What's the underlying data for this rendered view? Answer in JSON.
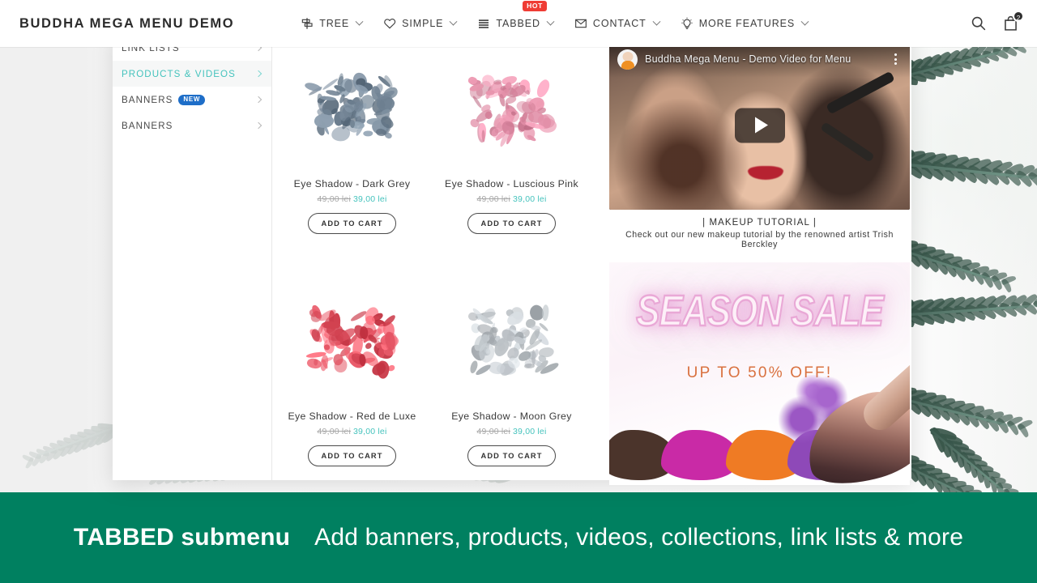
{
  "header": {
    "logo": "BUDDHA MEGA MENU DEMO",
    "nav": [
      {
        "label": "TREE",
        "icon": "signpost-icon",
        "badge": null
      },
      {
        "label": "SIMPLE",
        "icon": "heart-icon",
        "badge": null
      },
      {
        "label": "TABBED",
        "icon": "bars-icon",
        "badge": "HOT"
      },
      {
        "label": "CONTACT",
        "icon": "envelope-icon",
        "badge": null
      },
      {
        "label": "MORE FEATURES",
        "icon": "lightbulb-icon",
        "badge": null
      }
    ],
    "search_icon": "search-icon",
    "cart_icon": "shopping-bag-icon",
    "cart_count": "2"
  },
  "mega_menu": {
    "tabs": [
      {
        "label": "LINK LISTS",
        "badge": null,
        "active": false
      },
      {
        "label": "PRODUCTS & VIDEOS",
        "badge": null,
        "active": true
      },
      {
        "label": "BANNERS",
        "badge": "NEW",
        "active": false
      },
      {
        "label": "BANNERS",
        "badge": null,
        "active": false
      }
    ],
    "products": [
      {
        "title": "Eye Shadow - Dark Grey",
        "old_price": "49,00 lei",
        "new_price": "39,00 lei",
        "button": "ADD TO CART",
        "swatch": "#6b7d8e"
      },
      {
        "title": "Eye Shadow - Luscious Pink",
        "old_price": "49,00 lei",
        "new_price": "39,00 lei",
        "button": "ADD TO CART",
        "swatch": "#dd8aa3"
      },
      {
        "title": "Eye Shadow - Red de Luxe",
        "old_price": "49,00 lei",
        "new_price": "39,00 lei",
        "button": "ADD TO CART",
        "swatch": "#e0505f"
      },
      {
        "title": "Eye Shadow - Moon Grey",
        "old_price": "49,00 lei",
        "new_price": "39,00 lei",
        "button": "ADD TO CART",
        "swatch": "#b9bfc4"
      }
    ],
    "video": {
      "title": "Buddha Mega Menu - Demo Video for Menu",
      "avatar": "buddha-avatar-icon",
      "play_icon": "play-icon",
      "menu_icon": "kebab-menu-icon",
      "caption_title": "| MAKEUP TUTORIAL |",
      "caption_text": "Check out our new makeup tutorial by the renowned artist Trish Berckley"
    },
    "banner": {
      "title": "SEASON SALE",
      "subtitle": "UP TO 50% OFF!"
    }
  },
  "footer_banner": {
    "highlight": "TABBED submenu",
    "text": "Add banners, products, videos, collections, link lists & more"
  },
  "colors": {
    "accent_teal": "#45c3bd",
    "brand_green": "#008060",
    "hot_red": "#ef3c34",
    "new_blue": "#1e6ec8",
    "sale_orange": "#d9713f",
    "sale_pink": "#e9a8d6"
  }
}
